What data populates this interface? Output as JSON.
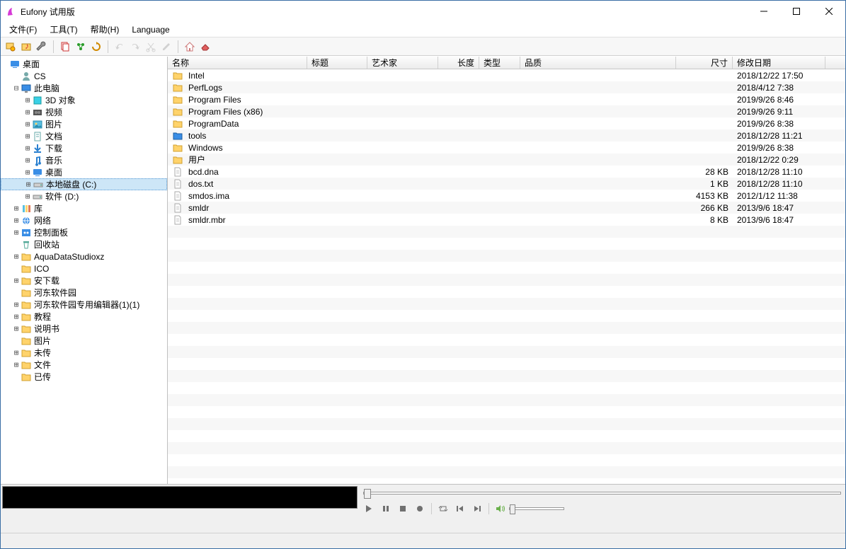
{
  "window": {
    "title": "Eufony 试用版"
  },
  "menu": {
    "file": "文件(F)",
    "tools": "工具(T)",
    "help": "帮助(H)",
    "language": "Language"
  },
  "tree": [
    {
      "depth": 0,
      "exp": "",
      "icon": "desktop",
      "label": "桌面"
    },
    {
      "depth": 1,
      "exp": "",
      "icon": "user",
      "label": "CS"
    },
    {
      "depth": 1,
      "exp": "-",
      "icon": "computer",
      "label": "此电脑"
    },
    {
      "depth": 2,
      "exp": "+",
      "icon": "3d",
      "label": "3D 对象"
    },
    {
      "depth": 2,
      "exp": "+",
      "icon": "video",
      "label": "视频"
    },
    {
      "depth": 2,
      "exp": "+",
      "icon": "pictures",
      "label": "图片"
    },
    {
      "depth": 2,
      "exp": "+",
      "icon": "documents",
      "label": "文档"
    },
    {
      "depth": 2,
      "exp": "+",
      "icon": "downloads",
      "label": "下载"
    },
    {
      "depth": 2,
      "exp": "+",
      "icon": "music",
      "label": "音乐"
    },
    {
      "depth": 2,
      "exp": "+",
      "icon": "desktop",
      "label": "桌面"
    },
    {
      "depth": 2,
      "exp": "+",
      "icon": "drive",
      "label": "本地磁盘 (C:)",
      "selected": true
    },
    {
      "depth": 2,
      "exp": "+",
      "icon": "drive",
      "label": "软件 (D:)"
    },
    {
      "depth": 1,
      "exp": "+",
      "icon": "library",
      "label": "库"
    },
    {
      "depth": 1,
      "exp": "+",
      "icon": "network",
      "label": "网络"
    },
    {
      "depth": 1,
      "exp": "+",
      "icon": "control",
      "label": "控制面板"
    },
    {
      "depth": 1,
      "exp": "",
      "icon": "recycle",
      "label": "回收站"
    },
    {
      "depth": 1,
      "exp": "+",
      "icon": "folder",
      "label": "AquaDataStudioxz"
    },
    {
      "depth": 1,
      "exp": "",
      "icon": "folder",
      "label": "ICO"
    },
    {
      "depth": 1,
      "exp": "+",
      "icon": "folder",
      "label": "安下载"
    },
    {
      "depth": 1,
      "exp": "",
      "icon": "folder",
      "label": "河东软件园"
    },
    {
      "depth": 1,
      "exp": "+",
      "icon": "folder",
      "label": "河东软件园专用编辑器(1)(1)"
    },
    {
      "depth": 1,
      "exp": "+",
      "icon": "folder",
      "label": "教程"
    },
    {
      "depth": 1,
      "exp": "+",
      "icon": "folder",
      "label": "说明书"
    },
    {
      "depth": 1,
      "exp": "",
      "icon": "folder",
      "label": "图片"
    },
    {
      "depth": 1,
      "exp": "+",
      "icon": "folder",
      "label": "未传"
    },
    {
      "depth": 1,
      "exp": "+",
      "icon": "folder",
      "label": "文件"
    },
    {
      "depth": 1,
      "exp": "",
      "icon": "folder",
      "label": "已传"
    }
  ],
  "headers": {
    "name": "名称",
    "title": "标题",
    "artist": "艺术家",
    "length": "长度",
    "type": "类型",
    "quality": "品质",
    "size": "尺寸",
    "date": "修改日期"
  },
  "files": [
    {
      "icon": "folder",
      "name": "Intel",
      "size": "",
      "date": "2018/12/22 17:50"
    },
    {
      "icon": "folder",
      "name": "PerfLogs",
      "size": "",
      "date": "2018/4/12 7:38"
    },
    {
      "icon": "folder",
      "name": "Program Files",
      "size": "",
      "date": "2019/9/26 8:46"
    },
    {
      "icon": "folder",
      "name": "Program Files (x86)",
      "size": "",
      "date": "2019/9/26 9:11"
    },
    {
      "icon": "folder",
      "name": "ProgramData",
      "size": "",
      "date": "2019/9/26 8:38"
    },
    {
      "icon": "folder-blue",
      "name": "tools",
      "size": "",
      "date": "2018/12/28 11:21"
    },
    {
      "icon": "folder",
      "name": "Windows",
      "size": "",
      "date": "2019/9/26 8:38"
    },
    {
      "icon": "folder",
      "name": "用户",
      "size": "",
      "date": "2018/12/22 0:29"
    },
    {
      "icon": "file",
      "name": "bcd.dna",
      "size": "28 KB",
      "date": "2018/12/28 11:10"
    },
    {
      "icon": "file",
      "name": "dos.txt",
      "size": "1 KB",
      "date": "2018/12/28 11:10"
    },
    {
      "icon": "file",
      "name": "smdos.ima",
      "size": "4153 KB",
      "date": "2012/1/12 11:38"
    },
    {
      "icon": "file",
      "name": "smldr",
      "size": "266 KB",
      "date": "2013/9/6 18:47"
    },
    {
      "icon": "file",
      "name": "smldr.mbr",
      "size": "8 KB",
      "date": "2013/9/6 18:47"
    }
  ]
}
